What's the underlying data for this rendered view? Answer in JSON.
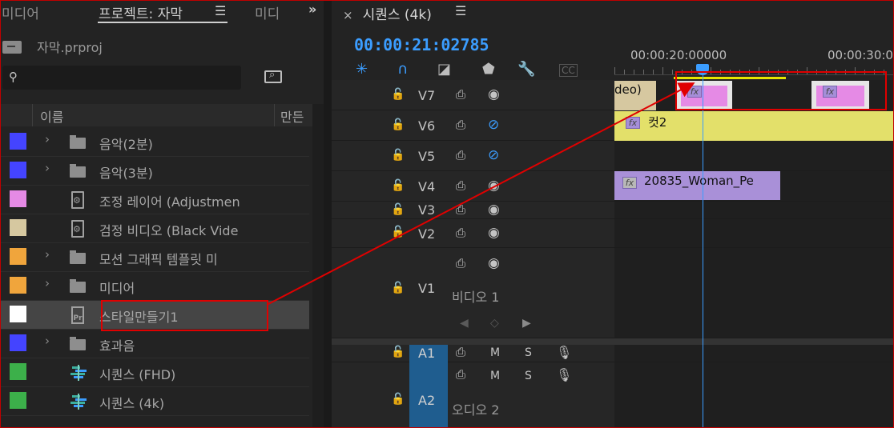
{
  "left_panel": {
    "tabs": [
      "미디어",
      "프로젝트: 자막",
      "미디"
    ],
    "project_file": "자막.prproj",
    "search_placeholder": "",
    "columns": [
      "이름",
      "만든"
    ],
    "items": [
      {
        "label": "음악(2분)",
        "color": "#4444ff",
        "type": "folder",
        "expandable": true
      },
      {
        "label": "음악(3분)",
        "color": "#4444ff",
        "type": "folder",
        "expandable": true
      },
      {
        "label": "조정 레이어 (Adjustmen",
        "color": "#e58ae5",
        "type": "adjust",
        "expandable": false
      },
      {
        "label": "검정 비디오 (Black Vide",
        "color": "#d6c8a0",
        "type": "adjust",
        "expandable": false
      },
      {
        "label": "모션 그래픽 템플릿 미",
        "color": "#f0a53c",
        "type": "folder",
        "expandable": true
      },
      {
        "label": "미디어",
        "color": "#f0a53c",
        "type": "folder",
        "expandable": true
      },
      {
        "label": "스타일만들기1",
        "color": "#ffffff",
        "type": "project",
        "expandable": false,
        "selected": true
      },
      {
        "label": "효과음",
        "color": "#4444ff",
        "type": "folder",
        "expandable": true
      },
      {
        "label": "시퀀스 (FHD)",
        "color": "#3cb04a",
        "type": "sequence",
        "expandable": false
      },
      {
        "label": "시퀀스 (4k)",
        "color": "#3cb04a",
        "type": "sequence",
        "expandable": false
      }
    ]
  },
  "timeline": {
    "tab_close": "×",
    "tab_title": "시퀀스 (4k)",
    "timecode": "00:00:21:02785",
    "ruler_labels": [
      "00:00:20:00000",
      "00:00:30:0"
    ],
    "video_tracks": [
      {
        "name": "V7",
        "eye": "on"
      },
      {
        "name": "V6",
        "eye": "off"
      },
      {
        "name": "V5",
        "eye": "off"
      },
      {
        "name": "V4",
        "eye": "on"
      },
      {
        "name": "V3",
        "eye": "on"
      },
      {
        "name": "V2",
        "eye": "on"
      },
      {
        "name": "V1",
        "eye": "on",
        "label": "비디오 1"
      }
    ],
    "audio_tracks": [
      {
        "name": "A1",
        "m": "M",
        "s": "S"
      },
      {
        "name": "A2",
        "m": "M",
        "s": "S",
        "label": "오디오 2"
      }
    ],
    "clips": {
      "v7_first": "deo)",
      "v6": "컷2",
      "v4": "20835_Woman_Pe",
      "fx": "fx"
    }
  },
  "icons": {
    "lock": "lock-icon",
    "eye": "eye-icon",
    "film": "film-icon",
    "mic": "mic-icon"
  }
}
